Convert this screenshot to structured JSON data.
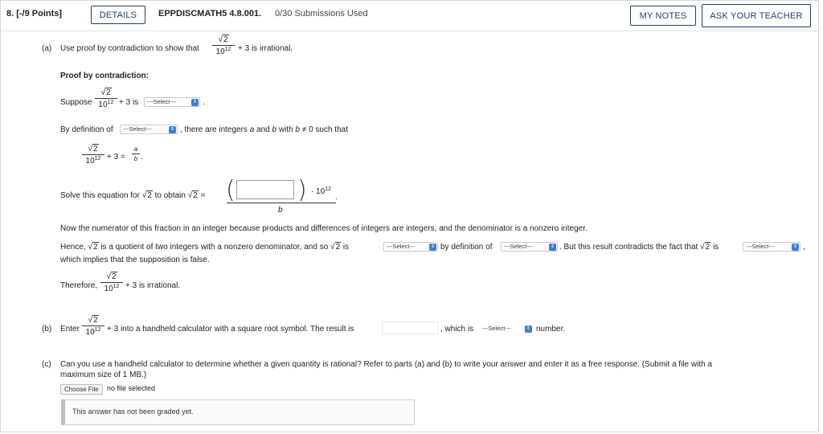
{
  "header": {
    "question_number": "8. [-/9 Points]",
    "details_button": "DETAILS",
    "problem_id": "EPPDISCMATH5 4.8.001.",
    "submissions": "0/30 Submissions Used",
    "my_notes_button": "MY NOTES",
    "ask_teacher_button": "ASK YOUR TEACHER"
  },
  "part_a": {
    "label": "(a)",
    "prompt_pre": "Use proof by contradiction to show that",
    "prompt_post": "+ 3 is irrational.",
    "sqrt2": "2",
    "ten": "10",
    "exp": "12",
    "proof_heading": "Proof by contradiction:",
    "suppose": "Suppose",
    "plus3is": "+ 3 is",
    "select1": "---Select---",
    "period": ".",
    "by_def_pre": "By definition of",
    "select2": "---Select---",
    "by_def_post_1": ", there are integers",
    "var_a": "a",
    "and": "and",
    "var_b": "b",
    "with": "with",
    "b_neq": "b",
    "neq_zero": "≠ 0 such that",
    "eq_plus3eq": "+ 3 =",
    "frac_a": "a",
    "frac_b": "b",
    "eq_period": ".",
    "solve_pre": "Solve this equation for",
    "to_obtain": "to obtain",
    "eq_sign": "=",
    "times_dot": "·",
    "solve_den": "b",
    "numerator_text": "Now the numerator of this fraction in an integer because products and differences of integers are integers, and the denominator is a nonzero integer.",
    "hence_pre": "Hence,",
    "hence_mid": "is a quotient of two integers with a nonzero denominator, and so",
    "is_word": "is",
    "select3": "---Select---",
    "by_def_word": "by definition of",
    "select4": "---Select---",
    "contradicts": ". But this result contradicts the fact that",
    "is_word2": "is",
    "select5": "---Select---",
    "comma": ",",
    "which_implies": "which implies that the supposition is false.",
    "therefore": "Therefore,",
    "therefore_post": "+ 3 is irrational."
  },
  "part_b": {
    "label": "(b)",
    "enter": "Enter",
    "post": "+ 3 into a handheld calculator with a square root symbol. The result is",
    "which_is": ", which is",
    "select": "---Select---",
    "number": "number."
  },
  "part_c": {
    "label": "(c)",
    "line1": "Can you use a handheld calculator to determine whether a given quantity is rational? Refer to parts (a) and (b) to write your answer and enter it as a free response. (Submit a file with a",
    "line2": "maximum size of 1 MB.)",
    "choose_file": "Choose File",
    "no_file": "no file selected",
    "graded": "This answer has not been graded yet."
  },
  "colors": {
    "button_border": "#1f3d73",
    "select_chevron": "#3b7fdc"
  },
  "icons": {
    "select_chevron": "chevron-updown-icon"
  }
}
